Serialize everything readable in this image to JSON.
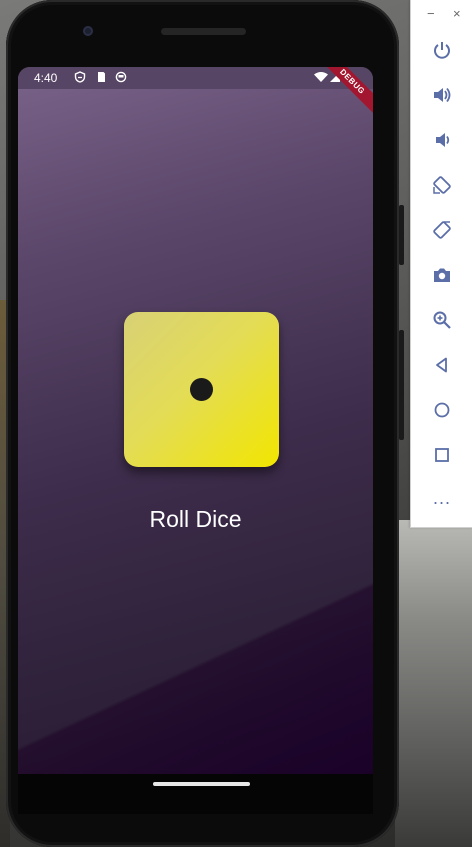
{
  "status_bar": {
    "time": "4:40",
    "icons": [
      "shield-icon",
      "sd-card-icon",
      "record-icon",
      "wifi-icon",
      "signal-icon",
      "battery-icon"
    ]
  },
  "debug_banner": "DEBUG",
  "app": {
    "dice_face_value": 1,
    "button_label": "Roll Dice"
  },
  "emulator_toolbar": {
    "window_controls": [
      "minimize",
      "close"
    ],
    "minimize_label": "−",
    "close_label": "×",
    "buttons": [
      "power",
      "volume-up",
      "volume-down",
      "rotate-left",
      "rotate-right",
      "screenshot",
      "zoom",
      "back",
      "home",
      "overview",
      "more"
    ],
    "more_label": "..."
  },
  "colors": {
    "dice_start": "#d8d176",
    "dice_end": "#f2e600",
    "screen_top": "#7a6389",
    "screen_bottom": "#26172f",
    "toolbar_icon": "#5b6ea8",
    "debug_red": "#a3162f"
  }
}
